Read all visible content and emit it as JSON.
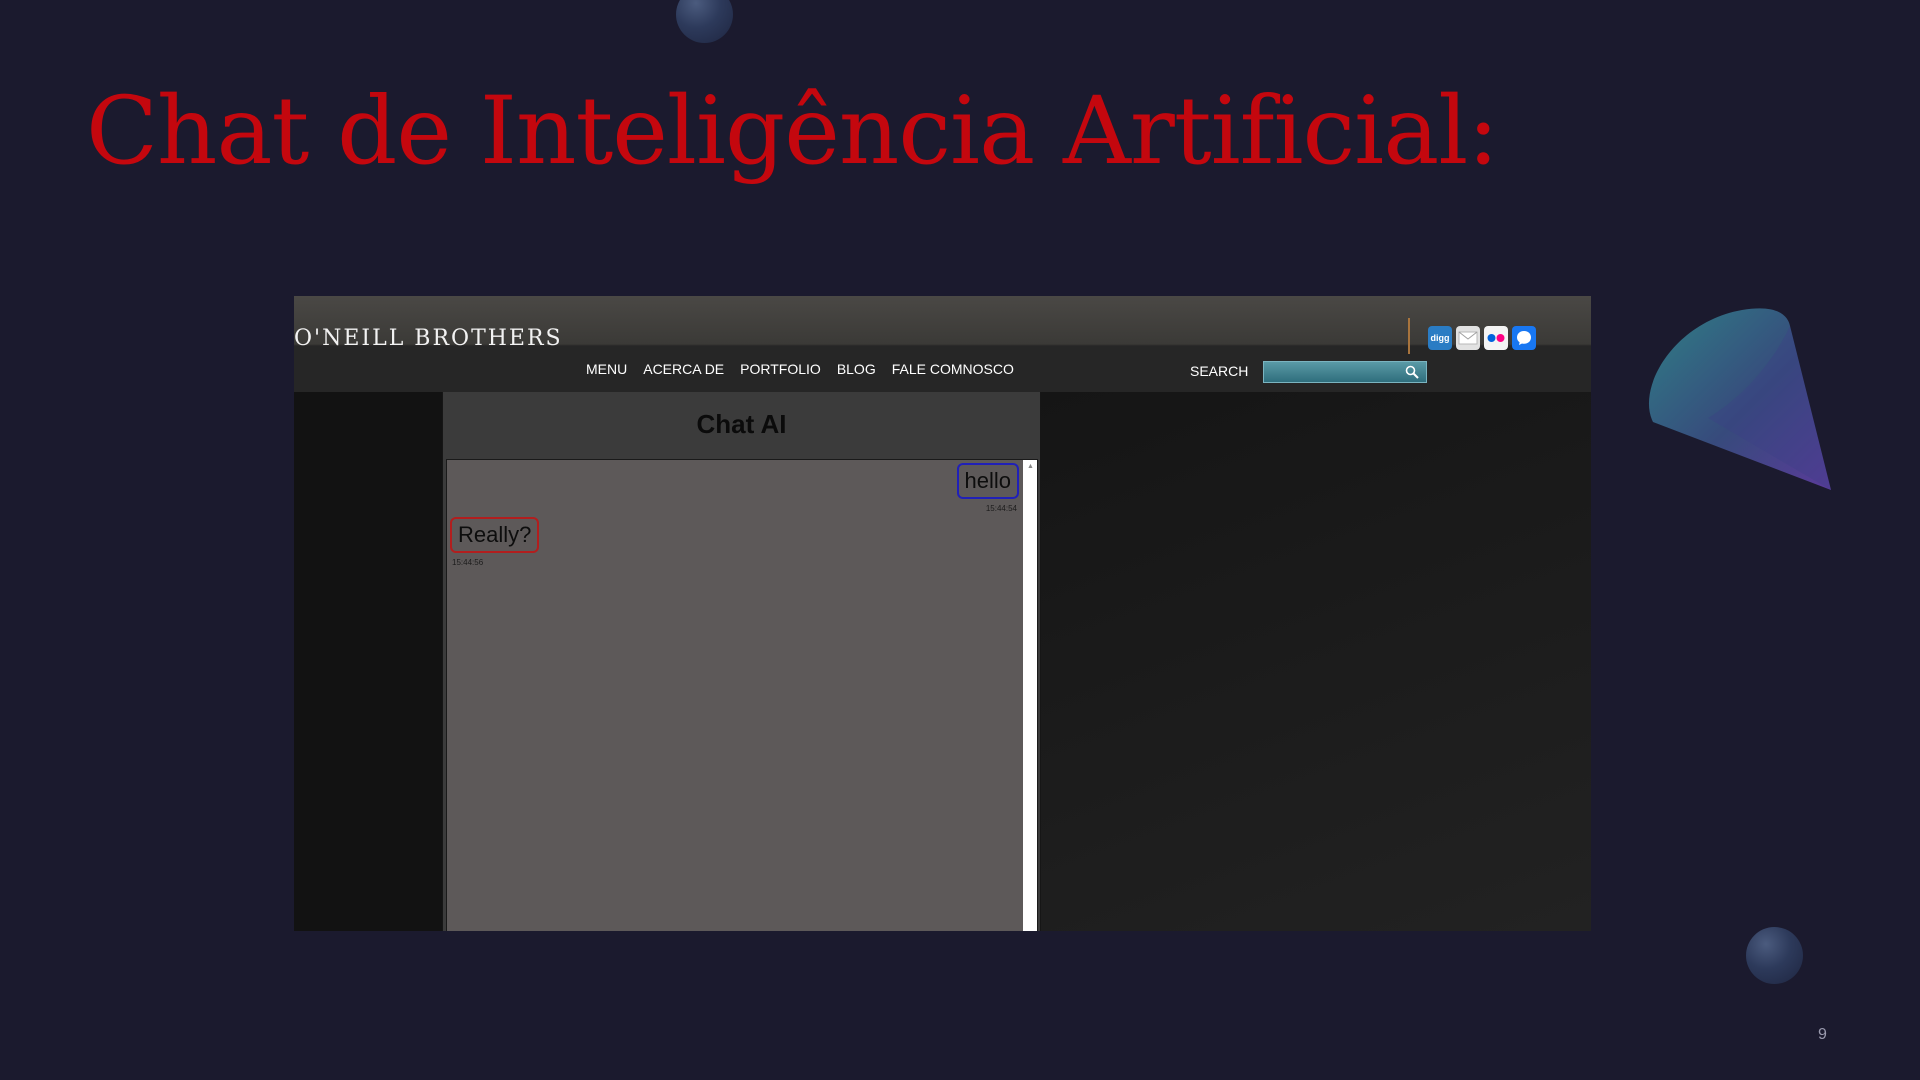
{
  "slide": {
    "title": "Chat de Inteligência Artificial:",
    "page_number": "9"
  },
  "site": {
    "brand": "O'NEILL BROTHERS",
    "nav": [
      "MENU",
      "ACERCA DE",
      "PORTFOLIO",
      "BLOG",
      "FALE COMNOSCO"
    ],
    "search_label": "SEARCH",
    "social_icons": [
      {
        "name": "digg-icon",
        "label": "digg"
      },
      {
        "name": "mail-icon"
      },
      {
        "name": "flickr-icon"
      },
      {
        "name": "chat-app-icon"
      }
    ]
  },
  "chat": {
    "title": "Chat AI",
    "messages": [
      {
        "sender": "user",
        "text": "hello",
        "time": "15:44:54"
      },
      {
        "sender": "bot",
        "text": "Really?",
        "time": "15:44:56"
      }
    ]
  },
  "colors": {
    "title": "#c4070e",
    "background": "#1b1a2e",
    "user_bubble_border": "#2020b8",
    "bot_bubble_border": "#b21e1e"
  }
}
